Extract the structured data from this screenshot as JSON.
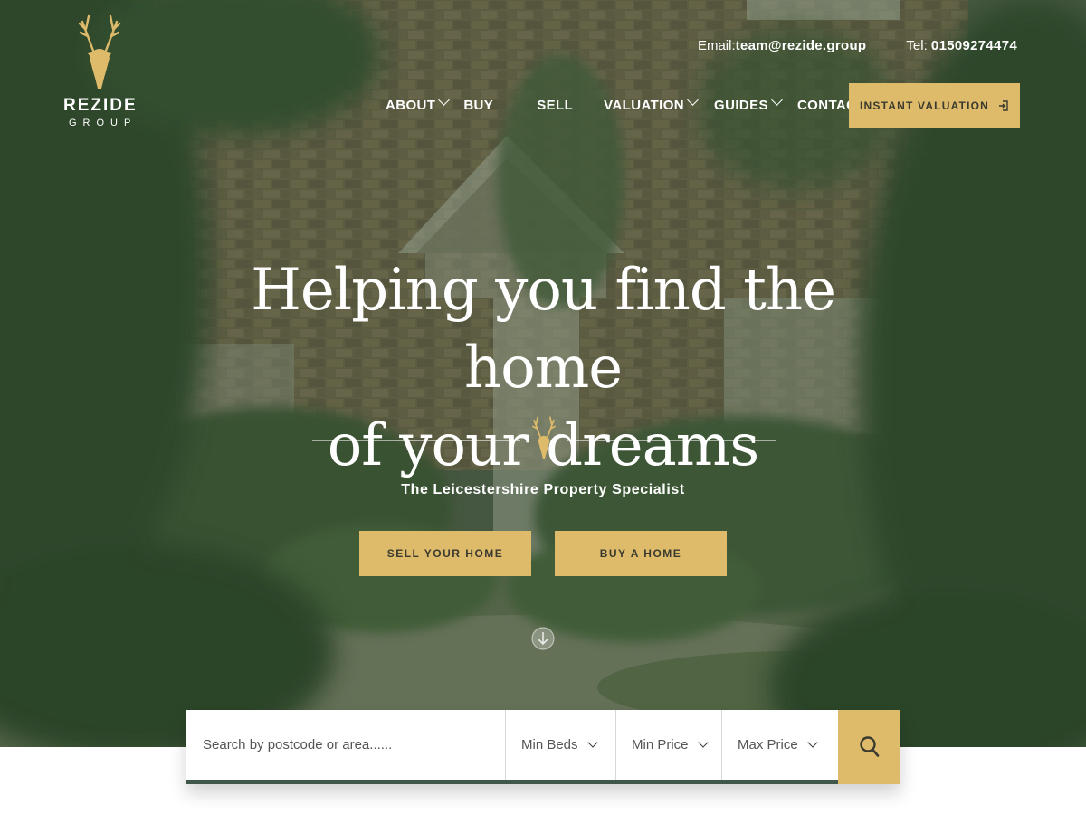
{
  "brand": {
    "name": "REZIDE",
    "sub": "GROUP"
  },
  "contact": {
    "email_label": "Email:",
    "email": "team@rezide.group",
    "tel_label": "Tel: ",
    "tel": "01509274474"
  },
  "nav": {
    "items": [
      {
        "label": "ABOUT",
        "dropdown": true
      },
      {
        "label": "BUY",
        "dropdown": false
      },
      {
        "label": "SELL",
        "dropdown": false
      },
      {
        "label": "VALUATION",
        "dropdown": true
      },
      {
        "label": "GUIDES",
        "dropdown": true
      },
      {
        "label": "CONTACT",
        "dropdown": false
      }
    ],
    "instant_valuation": "INSTANT VALUATION"
  },
  "hero": {
    "headline_line1": "Helping you find the home",
    "headline_line2": "of your dreams",
    "tagline": "The Leicestershire Property Specialist",
    "sell_button": "SELL YOUR HOME",
    "buy_button": "BUY A HOME"
  },
  "search": {
    "placeholder": "Search by postcode or area......",
    "min_beds": "Min Beds",
    "min_price": "Min Price",
    "max_price": "Max Price"
  },
  "colors": {
    "accent": "#deba6b",
    "dark_green": "#3e5748",
    "overlay": "#2e462e"
  }
}
